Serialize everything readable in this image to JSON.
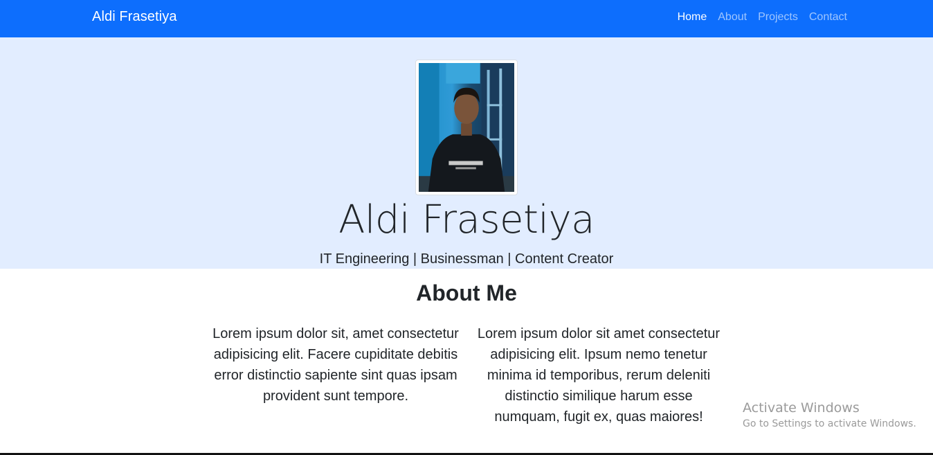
{
  "navbar": {
    "brand": "Aldi Frasetiya",
    "links": [
      "Home",
      "About",
      "Projects",
      "Contact"
    ],
    "active_index": 0,
    "bg_color": "#0d6efd"
  },
  "hero": {
    "name": "Aldi Frasetiya",
    "tagline": "IT Engineering | Businessman | Content Creator",
    "bg_color": "#e2edff"
  },
  "about": {
    "title": "About Me",
    "paragraphs": [
      "Lorem ipsum dolor sit, amet consectetur adipisicing elit. Facere cupiditate debitis error distinctio sapiente sint quas ipsam provident sunt tempore.",
      "Lorem ipsum dolor sit amet consectetur adipisicing elit. Ipsum nemo tenetur minima id temporibus, rerum deleniti distinctio similique harum esse numquam, fugit ex, quas maiores!"
    ]
  },
  "watermark": {
    "title": "Activate Windows",
    "subtitle": "Go to Settings to activate Windows."
  }
}
